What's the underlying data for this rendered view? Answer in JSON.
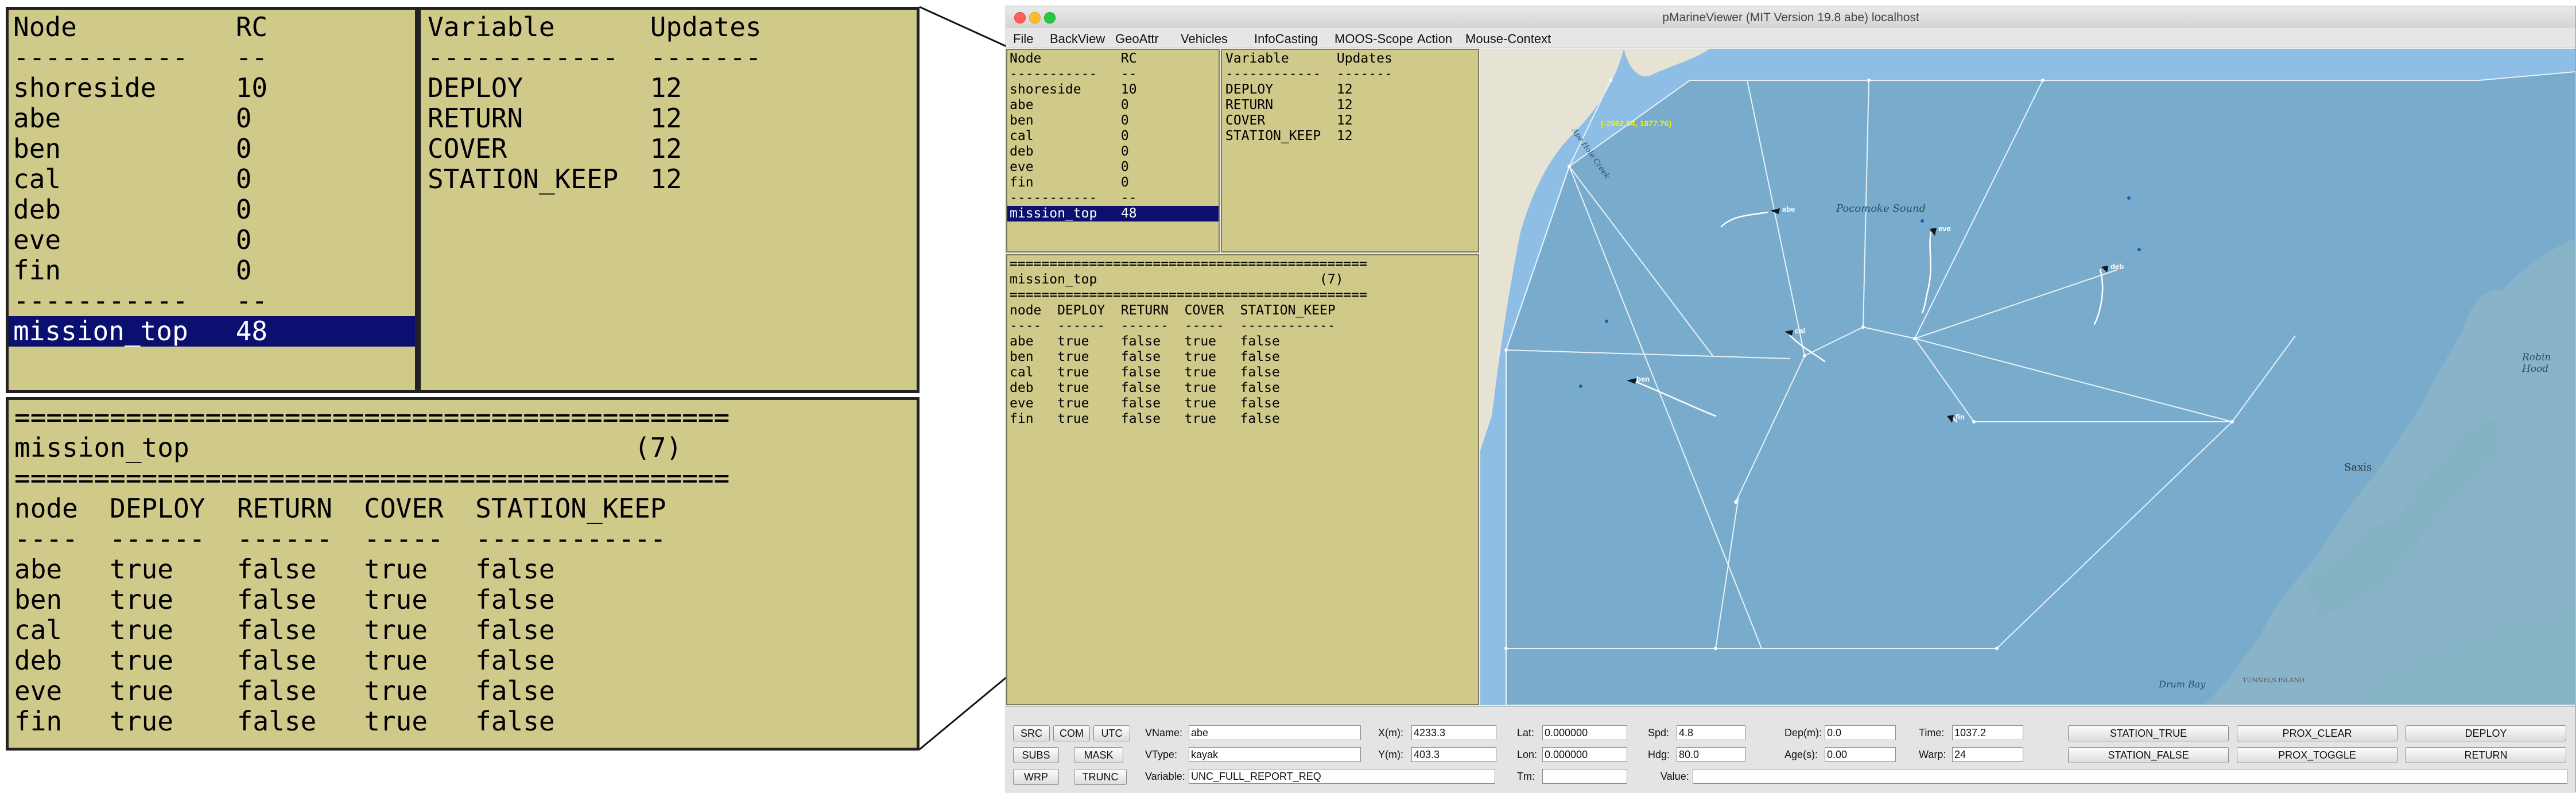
{
  "window": {
    "title": "pMarineViewer (MIT Version 19.8 abe) localhost"
  },
  "menu": [
    "File",
    "BackView",
    "GeoAttr",
    "Vehicles",
    "InfoCasting",
    "MOOS-Scope",
    "Action",
    "Mouse-Context"
  ],
  "nodes_pane": {
    "header": "Node          RC",
    "divider": "-----------   --",
    "rows": [
      "shoreside     10",
      "abe           0",
      "ben           0",
      "cal           0",
      "deb           0",
      "eve           0",
      "fin           0"
    ],
    "divider2": "-----------   --",
    "selected": "mission_top   48"
  },
  "vars_pane": {
    "header": "Variable      Updates",
    "divider": "------------  -------",
    "rows": [
      "DEPLOY        12",
      "RETURN        12",
      "COVER         12",
      "STATION_KEEP  12"
    ]
  },
  "report_pane": {
    "rule": "=============================================",
    "title": "mission_top                            (7)",
    "header": "node  DEPLOY  RETURN  COVER  STATION_KEEP",
    "divider": "----  ------  ------  -----  ------------",
    "rows": [
      "abe   true    false   true   false",
      "ben   true    false   true   false",
      "cal   true    false   true   false",
      "deb   true    false   true   false",
      "eve   true    false   true   false",
      "fin   true    false   true   false"
    ]
  },
  "map": {
    "cursor_coord": "(-2962.54, 1877.76)",
    "labels": {
      "sound": "Pocomoke Sound",
      "bay": "Drum Bay",
      "town": "Saxis",
      "right_edge": "Robin Hood",
      "creek": "Ape Hole Creek",
      "island": "TUNNELS ISLAND"
    },
    "vehicles": [
      "abe",
      "ben",
      "cal",
      "deb",
      "eve",
      "fin"
    ]
  },
  "controls": {
    "buttons_left": [
      "SRC",
      "COM",
      "UTC",
      "SUBS",
      "MASK",
      "WRP",
      "TRUNC"
    ],
    "vname_label": "VName:",
    "vname": "abe",
    "vtype_label": "VType:",
    "vtype": "kayak",
    "variable_label": "Variable:",
    "variable": "UNC_FULL_REPORT_REQ",
    "xm_label": "X(m):",
    "xm": "4233.3",
    "ym_label": "Y(m):",
    "ym": "403.3",
    "lat_label": "Lat:",
    "lat": "0.000000",
    "lon_label": "Lon:",
    "lon": "0.000000",
    "tm_label": "Tm:",
    "tm": "",
    "spd_label": "Spd:",
    "spd": "4.8",
    "hdg_label": "Hdg:",
    "hdg": "80.0",
    "dep_label": "Dep(m):",
    "dep": "0.0",
    "age_label": "Age(s):",
    "age": "0.00",
    "time_label": "Time:",
    "time": "1037.2",
    "warp_label": "Warp:",
    "warp": "24",
    "value_label": "Value:",
    "value": "",
    "actions": [
      "STATION_TRUE",
      "PROX_CLEAR",
      "DEPLOY",
      "STATION_FALSE",
      "PROX_TOGGLE",
      "RETURN"
    ]
  },
  "colors": {
    "pane": "#cfc98a",
    "highlight": "#0b1070",
    "water": "#8ebde6",
    "opregion": "#74a8c6",
    "land": "#e6e3d4"
  }
}
